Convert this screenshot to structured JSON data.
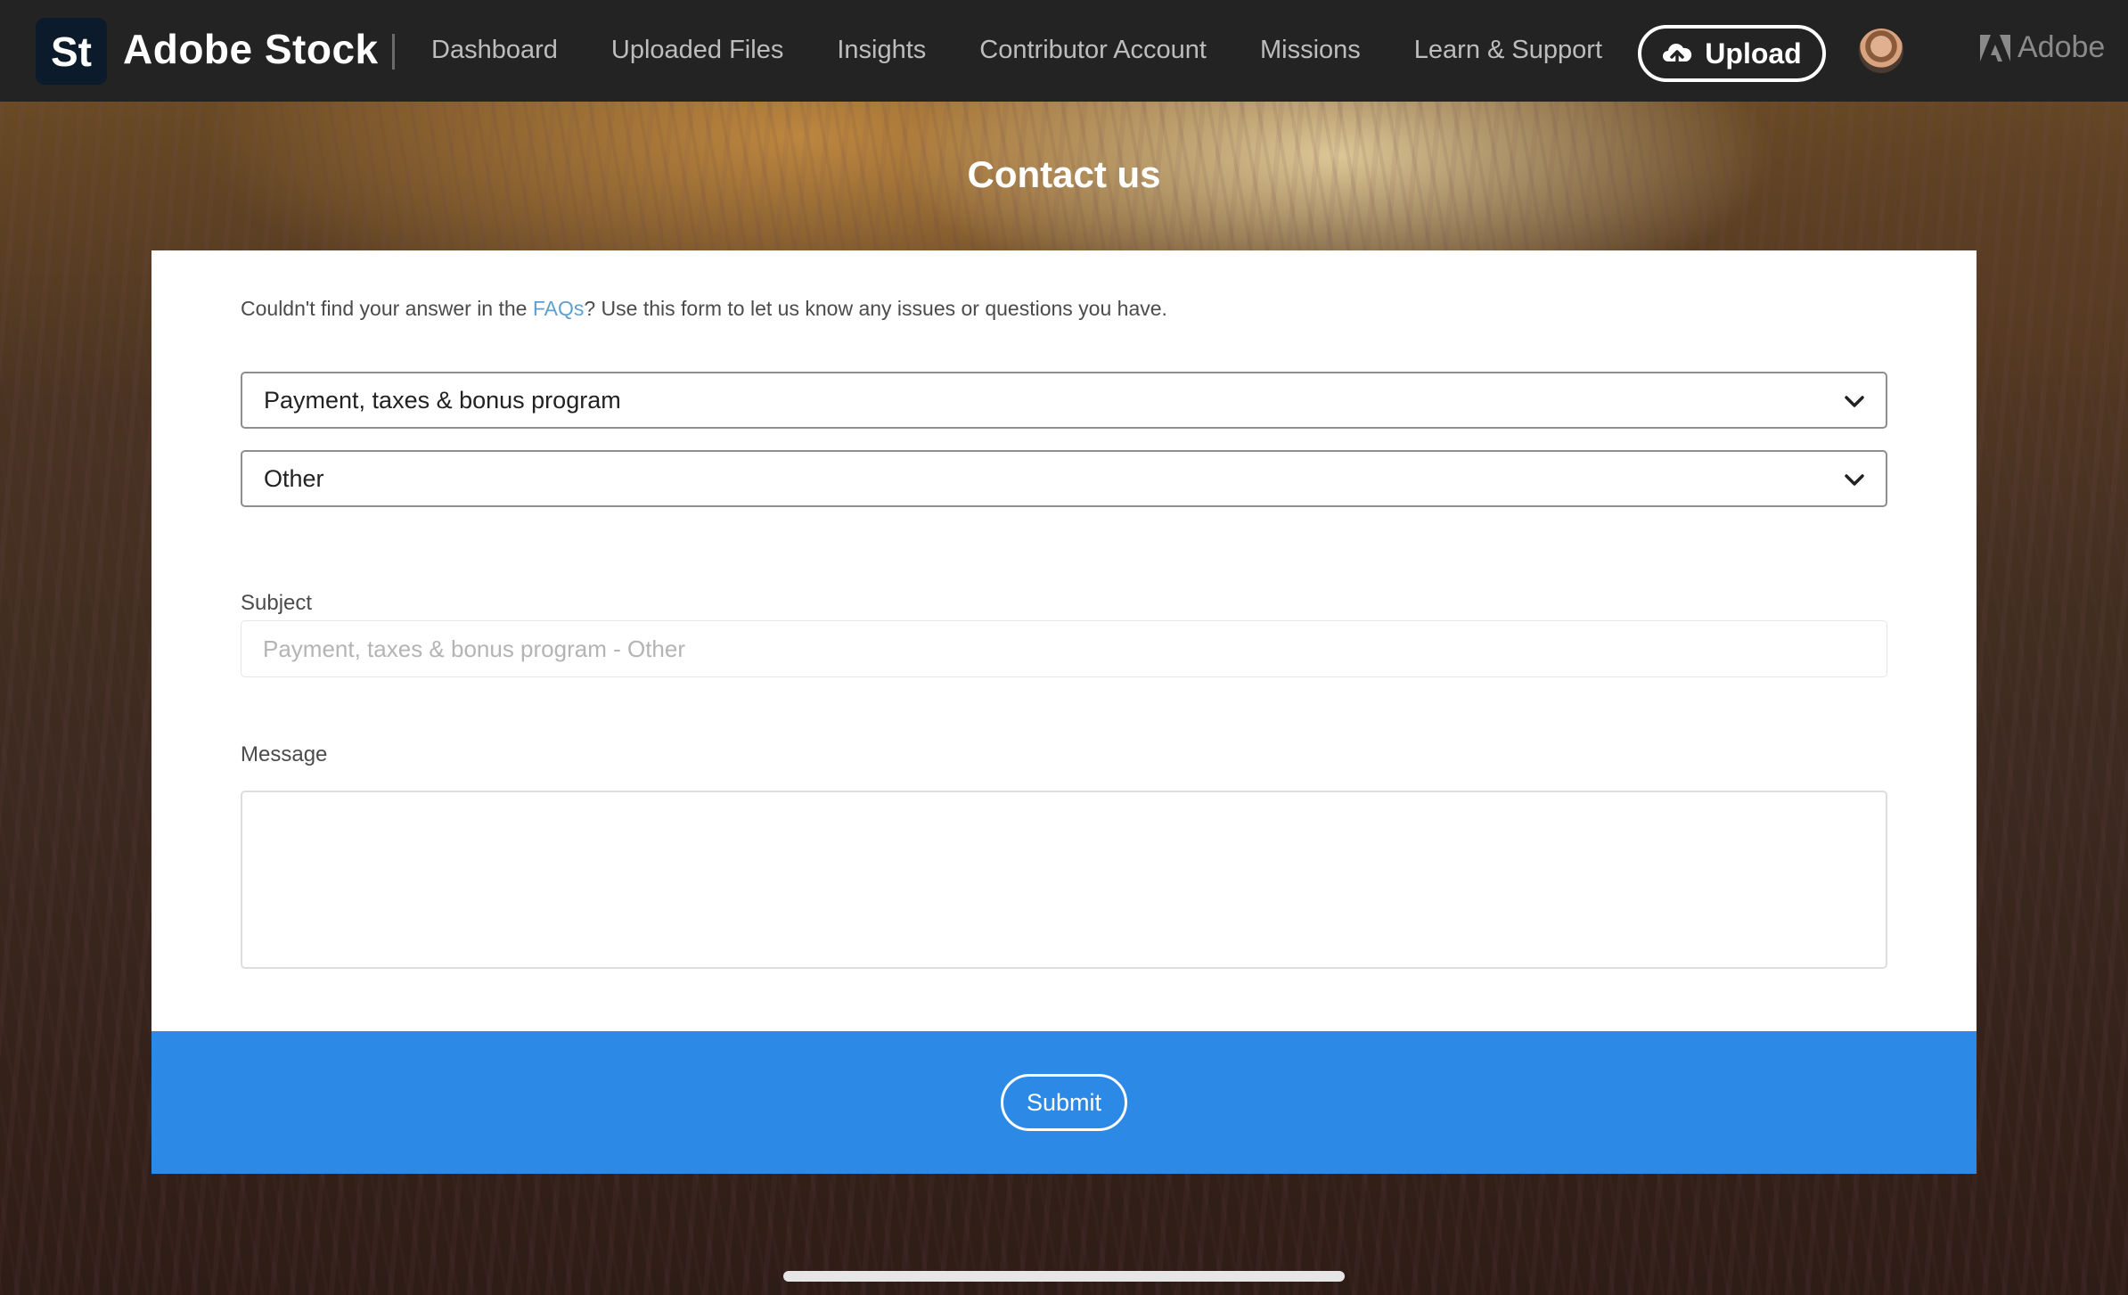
{
  "header": {
    "logo_badge": "St",
    "brand": "Adobe Stock",
    "nav": [
      "Dashboard",
      "Uploaded Files",
      "Insights",
      "Contributor Account",
      "Missions",
      "Learn & Support"
    ],
    "upload_label": "Upload",
    "adobe_label": "Adobe"
  },
  "page": {
    "title": "Contact us"
  },
  "form": {
    "intro_before": "Couldn't find your answer in the ",
    "intro_link": "FAQs",
    "intro_after": "? Use this form to let us know any issues or questions you have.",
    "category_value": "Payment, taxes & bonus program",
    "subcategory_value": "Other",
    "subject_label": "Subject",
    "subject_placeholder": "Payment, taxes & bonus program - Other",
    "subject_value": "",
    "message_label": "Message",
    "message_value": "",
    "submit_label": "Submit"
  },
  "colors": {
    "topbar": "#232323",
    "submit_bar": "#2d89e6",
    "link": "#5f9fcf"
  },
  "icons": {
    "upload": "cloud-upload-icon",
    "select": "chevron-down-icon",
    "adobe": "adobe-logo-icon"
  }
}
